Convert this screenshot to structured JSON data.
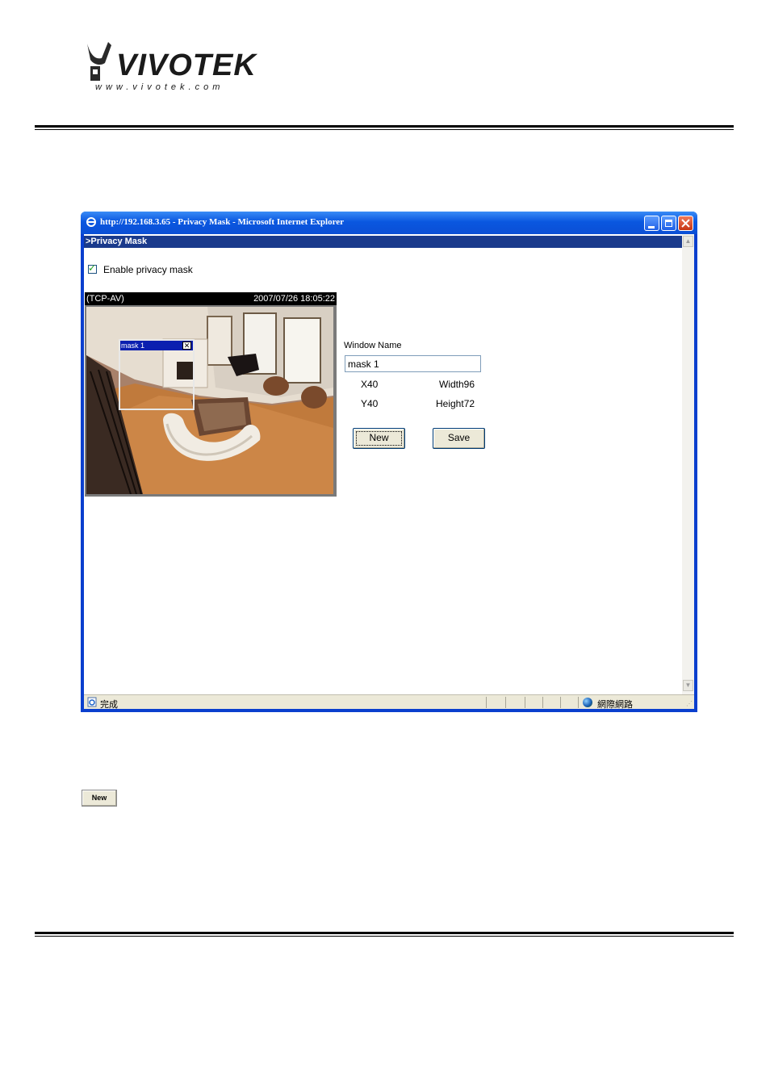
{
  "logo": {
    "brand": "VIVOTEK",
    "url": "www.vivotek.com"
  },
  "browser": {
    "title": "http://192.168.3.65 - Privacy Mask - Microsoft Internet Explorer",
    "status_text": "完成",
    "zone_text": "網際網路"
  },
  "page": {
    "heading": ">Privacy Mask",
    "enable_label": "Enable privacy mask",
    "enable_checked": true,
    "video": {
      "stream_label": "(TCP-AV)",
      "timestamp": "2007/07/26 18:05:22"
    },
    "mask": {
      "title": "mask 1"
    },
    "form": {
      "window_name_label": "Window Name",
      "window_name_value": "mask 1",
      "x_text": "X40",
      "y_text": "Y40",
      "width_text": "Width96",
      "height_text": "Height72",
      "new_label": "New",
      "save_label": "Save"
    }
  },
  "doc_button": {
    "label": "New"
  },
  "colors": {
    "titlebar": "#0a57e0",
    "heading_bar": "#1a3a8c",
    "mask_title": "#0a1fb0"
  }
}
